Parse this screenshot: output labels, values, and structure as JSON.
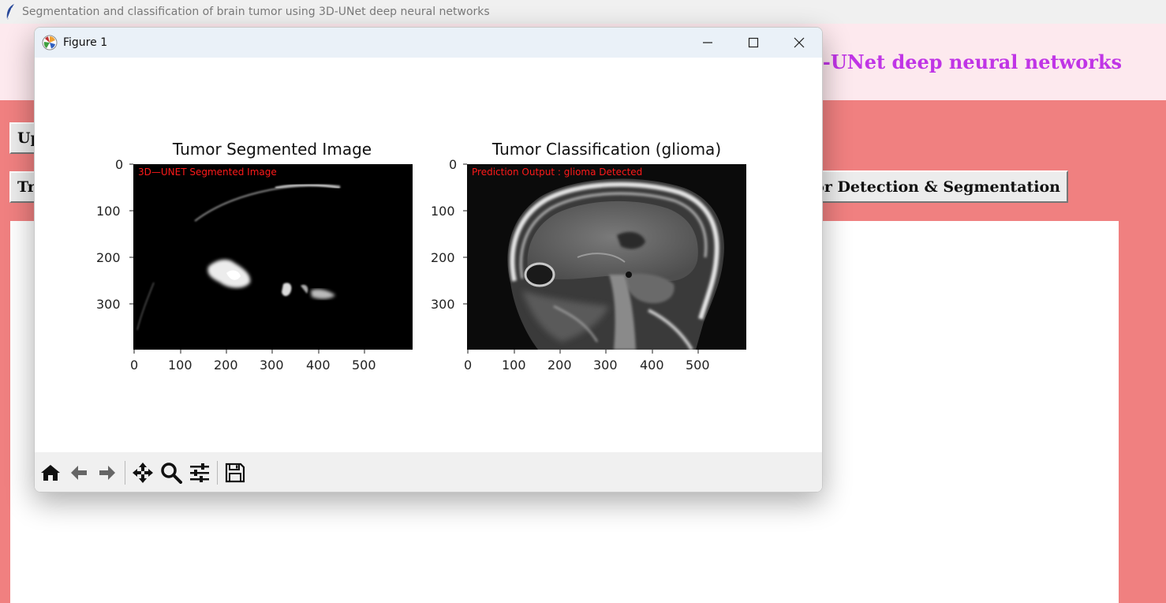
{
  "app": {
    "window_title": "Segmentation and classification of brain tumor using 3D-UNet deep neural networks",
    "heading_visible": "ing 3D-UNet deep neural networks",
    "buttons": {
      "upload_label": "Up",
      "train_label": "Tr",
      "detect_label": "Tumor Detection & Segmentation"
    },
    "colors": {
      "background": "#f08080",
      "heading_band": "#fde9ee",
      "heading_text": "#c035e6"
    }
  },
  "figure": {
    "window_title": "Figure 1",
    "subplots": [
      {
        "title": "Tumor Segmented Image",
        "overlay_text": "3D—UNET Segmented Image",
        "xticks": [
          "0",
          "100",
          "200",
          "300",
          "400",
          "500"
        ],
        "yticks": [
          "0",
          "100",
          "200",
          "300"
        ]
      },
      {
        "title": "Tumor Classification (glioma)",
        "overlay_text": "Prediction Output : glioma Detected",
        "xticks": [
          "0",
          "100",
          "200",
          "300",
          "400",
          "500"
        ],
        "yticks": [
          "0",
          "100",
          "200",
          "300"
        ]
      }
    ],
    "toolbar": [
      "home-icon",
      "back-arrow-icon",
      "forward-arrow-icon",
      "pan-icon",
      "zoom-icon",
      "configure-subplots-icon",
      "save-icon"
    ],
    "overlay_color": "#ff1a1a"
  }
}
